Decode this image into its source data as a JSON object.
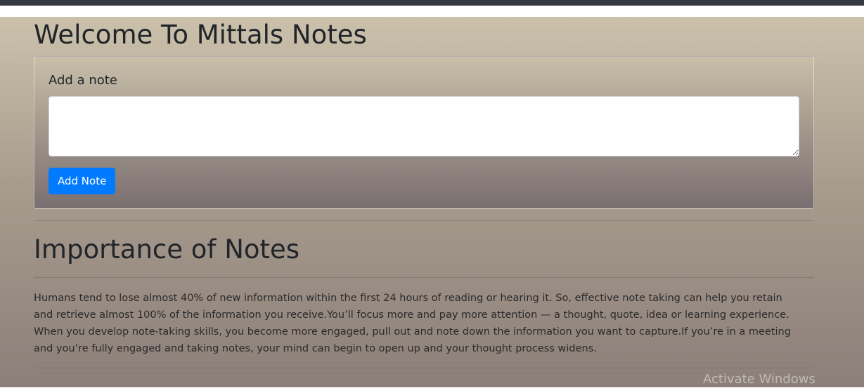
{
  "header": {
    "title": "Welcome To Mittals Notes"
  },
  "add_note": {
    "label": "Add a note",
    "input_value": "",
    "button_label": "Add Note"
  },
  "notes_section": {
    "title": "Importance of Notes",
    "body": "Humans tend to lose almost 40% of new information within the first 24 hours of reading or hearing it. So, effective note taking can help you retain and retrieve almost 100% of the information you receive.You’ll focus more and pay more attention — a thought, quote, idea or learning experience. When you develop note-taking skills, you become more engaged, pull out and note down the information you want to capture.If you’re in a meeting and you’re fully engaged and taking notes, your mind can begin to open up and your thought process widens."
  },
  "os_overlay": {
    "watermark": "Activate Windows"
  },
  "colors": {
    "accent": "#007bff",
    "topbar": "#343a40"
  }
}
